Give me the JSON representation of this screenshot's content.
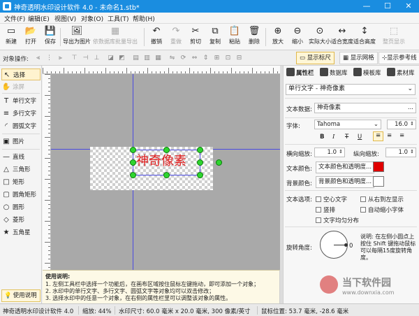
{
  "window": {
    "title": "神奇透明水印设计软件 4.0 - 未命名1.stb*",
    "minimize": "—",
    "maximize": "☐",
    "close": "✕"
  },
  "menu": [
    "文件(F)",
    "编辑(E)",
    "视图(V)",
    "对象(O)",
    "工具(T)",
    "帮助(H)"
  ],
  "toolbar": [
    {
      "label": "新建",
      "icon": "new-file-icon",
      "glyph": "▭",
      "disabled": false
    },
    {
      "label": "打开",
      "icon": "open-folder-icon",
      "glyph": "📂",
      "disabled": false
    },
    {
      "label": "保存",
      "icon": "save-icon",
      "glyph": "💾",
      "disabled": false
    },
    {
      "label": "导出为图片",
      "icon": "export-image-icon",
      "glyph": "🖼",
      "disabled": false
    },
    {
      "label": "依数据库批量导出",
      "icon": "batch-export-icon",
      "glyph": "▦",
      "disabled": true
    },
    {
      "label": "撤销",
      "icon": "undo-icon",
      "glyph": "↶",
      "disabled": false
    },
    {
      "label": "重做",
      "icon": "redo-icon",
      "glyph": "↷",
      "disabled": true
    },
    {
      "label": "剪切",
      "icon": "cut-icon",
      "glyph": "✂",
      "disabled": false
    },
    {
      "label": "复制",
      "icon": "copy-icon",
      "glyph": "⧉",
      "disabled": false
    },
    {
      "label": "粘贴",
      "icon": "paste-icon",
      "glyph": "📋",
      "disabled": false
    },
    {
      "label": "删除",
      "icon": "delete-icon",
      "glyph": "🗑",
      "disabled": false
    },
    {
      "label": "放大",
      "icon": "zoom-in-icon",
      "glyph": "⊕",
      "disabled": false
    },
    {
      "label": "缩小",
      "icon": "zoom-out-icon",
      "glyph": "⊖",
      "disabled": false
    },
    {
      "label": "实际大小",
      "icon": "actual-size-icon",
      "glyph": "⊙",
      "disabled": false
    },
    {
      "label": "适合宽度",
      "icon": "fit-width-icon",
      "glyph": "↔",
      "disabled": false
    },
    {
      "label": "适合高度",
      "icon": "fit-height-icon",
      "glyph": "↕",
      "disabled": false
    },
    {
      "label": "整页显示",
      "icon": "full-page-icon",
      "glyph": "⬚",
      "disabled": true
    }
  ],
  "objbar": {
    "label": "对象操作:",
    "show_ruler": "显示标尺",
    "show_grid": "显示网格",
    "show_guides": "显示参考线"
  },
  "tools": [
    {
      "label": "选择",
      "glyph": "↖",
      "icon": "select-arrow-icon",
      "selected": true,
      "disabled": false
    },
    {
      "label": "涂屏",
      "glyph": "✋",
      "icon": "hand-icon",
      "selected": false,
      "disabled": true
    },
    {
      "label": "单行文字",
      "glyph": "T",
      "icon": "single-line-text-icon",
      "selected": false,
      "disabled": false
    },
    {
      "label": "多行文字",
      "glyph": "≡",
      "icon": "multi-line-text-icon",
      "selected": false,
      "disabled": false
    },
    {
      "label": "圆弧文字",
      "glyph": "◜",
      "icon": "arc-text-icon",
      "selected": false,
      "disabled": false
    },
    {
      "label": "图片",
      "glyph": "▣",
      "icon": "picture-icon",
      "selected": false,
      "disabled": false
    },
    {
      "label": "直线",
      "glyph": "—",
      "icon": "line-icon",
      "selected": false,
      "disabled": false
    },
    {
      "label": "三角形",
      "glyph": "△",
      "icon": "triangle-icon",
      "selected": false,
      "disabled": false
    },
    {
      "label": "矩形",
      "glyph": "□",
      "icon": "rectangle-icon",
      "selected": false,
      "disabled": false
    },
    {
      "label": "圆角矩形",
      "glyph": "▢",
      "icon": "rounded-rectangle-icon",
      "selected": false,
      "disabled": false
    },
    {
      "label": "圆形",
      "glyph": "○",
      "icon": "circle-icon",
      "selected": false,
      "disabled": false
    },
    {
      "label": "菱形",
      "glyph": "◇",
      "icon": "diamond-icon",
      "selected": false,
      "disabled": false
    },
    {
      "label": "五角星",
      "glyph": "★",
      "icon": "star-icon",
      "selected": false,
      "disabled": false
    }
  ],
  "help_button": "使用说明",
  "canvas": {
    "watermark_text": "神奇像素"
  },
  "help": {
    "title": "使用说明:",
    "lines": [
      "1. 左侧工具栏中选择一个功能后，在画布区域按住鼠标左键拖动，即可添加一个对象；",
      "2. 水印中的单行文字、多行文字、圆弧文字等对象均可以双击修改；",
      "3. 选择水印中的任意一个对象，在右侧的属性栏里可以调整该对象的属性。"
    ]
  },
  "panel": {
    "tabs": [
      "属性栏",
      "数据库",
      "模板库",
      "素材库"
    ],
    "object_select": "单行文字 - 神奇像素",
    "text_data_label": "文本数据:",
    "text_data": "神奇像素",
    "more": "...",
    "font_label": "字体:",
    "font": "Tahoma",
    "font_size": "16.0",
    "style_bold": "B",
    "style_italic": "I",
    "style_strike": "T",
    "style_under": "U",
    "h_scale_label": "横向缩放:",
    "h_scale": "1.0",
    "v_scale_label": "纵向缩放:",
    "v_scale": "1.0",
    "text_color_label": "文本颜色:",
    "text_color_btn": "文本颜色和透明度...",
    "text_color": "#e00000",
    "bg_color_label": "背景颜色:",
    "bg_color_btn": "背景颜色和透明度...",
    "bg_color": "#ffffff",
    "text_options_label": "文本选项:",
    "opt_hollow": "空心文字",
    "opt_rtl": "从右到左显示",
    "opt_vertical": "竖排",
    "opt_autoshrink": "自动缩小字体",
    "opt_even": "文字均匀分布",
    "rotation_label": "旋转角度:",
    "rotation_value": "0",
    "rotation_note": "说明: 在左侧小圆点上按住 Shift 键拖动鼠标可以每隔15度旋转角度。"
  },
  "status": {
    "app": "神奇透明水印设计软件 4.0",
    "zoom": "缩放: 44%",
    "size": "水印尺寸: 60.0 毫米 x 20.0 毫米, 300 像素/英寸",
    "mouse": "鼠标位置: 53.7 毫米, -28.6 毫米"
  },
  "brand_logo": {
    "text": "当下软件园",
    "sub": "www.downxia.com"
  },
  "colors": {
    "titlebar": "#1a8de0",
    "watermark": "#e01e1e",
    "handle": "#2fd52f",
    "guide": "#4a4ae0"
  }
}
